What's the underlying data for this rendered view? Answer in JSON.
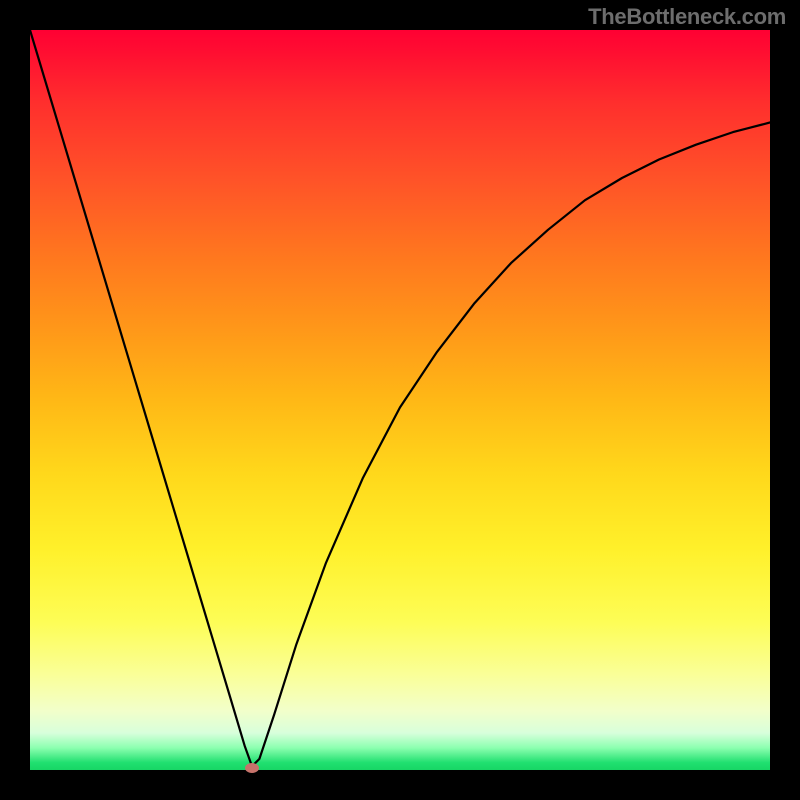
{
  "watermark": "TheBottleneck.com",
  "chart_data": {
    "type": "line",
    "title": "",
    "xlabel": "",
    "ylabel": "",
    "xlim": [
      0,
      1
    ],
    "ylim": [
      0,
      1
    ],
    "grid": false,
    "legend": false,
    "series": [
      {
        "name": "curve",
        "x": [
          0.0,
          0.03,
          0.06,
          0.09,
          0.12,
          0.15,
          0.18,
          0.21,
          0.24,
          0.27,
          0.29,
          0.3,
          0.31,
          0.33,
          0.36,
          0.4,
          0.45,
          0.5,
          0.55,
          0.6,
          0.65,
          0.7,
          0.75,
          0.8,
          0.85,
          0.9,
          0.95,
          1.0
        ],
        "y": [
          1.0,
          0.9,
          0.8,
          0.7,
          0.6,
          0.5,
          0.4,
          0.3,
          0.2,
          0.1,
          0.033,
          0.005,
          0.015,
          0.075,
          0.17,
          0.28,
          0.395,
          0.49,
          0.565,
          0.63,
          0.685,
          0.73,
          0.77,
          0.8,
          0.825,
          0.845,
          0.862,
          0.875
        ]
      }
    ],
    "marker": {
      "x": 0.3,
      "y": 0.003
    },
    "background": "gradient-red-to-green",
    "line_color": "#000000"
  }
}
